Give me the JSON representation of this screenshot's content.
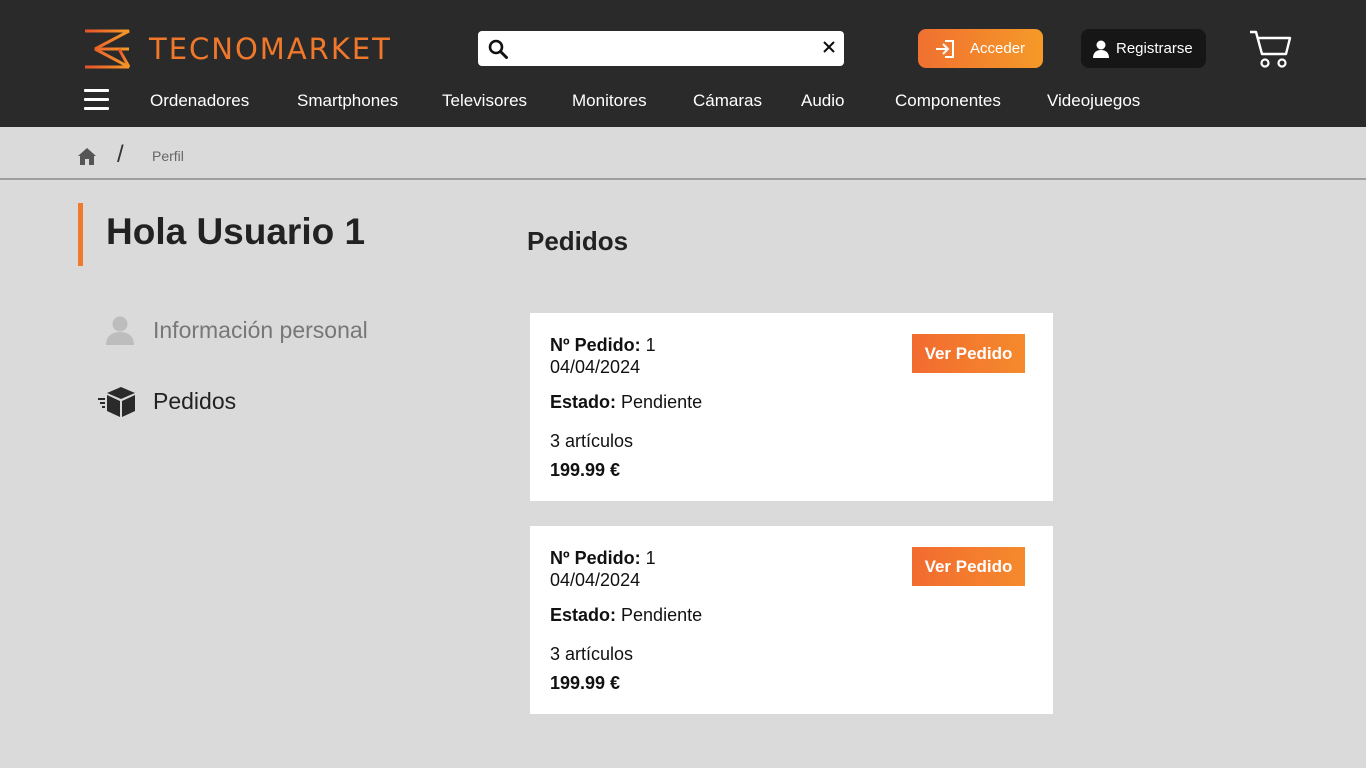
{
  "header": {
    "brand": "TECNOMARKET",
    "search_placeholder": "",
    "login_label": "Acceder",
    "register_label": "Registrarse"
  },
  "nav": {
    "items": [
      "Ordenadores",
      "Smartphones",
      "Televisores",
      "Monitores",
      "Cámaras",
      "Audio",
      "Componentes",
      "Videojuegos"
    ]
  },
  "breadcrumb": {
    "separator": "/",
    "current": "Perfil"
  },
  "profile": {
    "greeting": "Hola Usuario 1",
    "menu": [
      {
        "label": "Información personal",
        "icon": "user-icon"
      },
      {
        "label": "Pedidos",
        "icon": "box-icon"
      }
    ]
  },
  "orders": {
    "title": "Pedidos",
    "number_label": "Nº Pedido:",
    "status_label": "Estado:",
    "view_label": "Ver Pedido",
    "list": [
      {
        "number": "1",
        "date": "04/04/2024",
        "status": "Pendiente",
        "items": "3 artículos",
        "price": "199.99 €"
      },
      {
        "number": "1",
        "date": "04/04/2024",
        "status": "Pendiente",
        "items": "3 artículos",
        "price": "199.99 €"
      }
    ]
  },
  "colors": {
    "accent": "#f07a2c",
    "header_bg": "#2a2a2a",
    "page_bg": "#dadada"
  }
}
